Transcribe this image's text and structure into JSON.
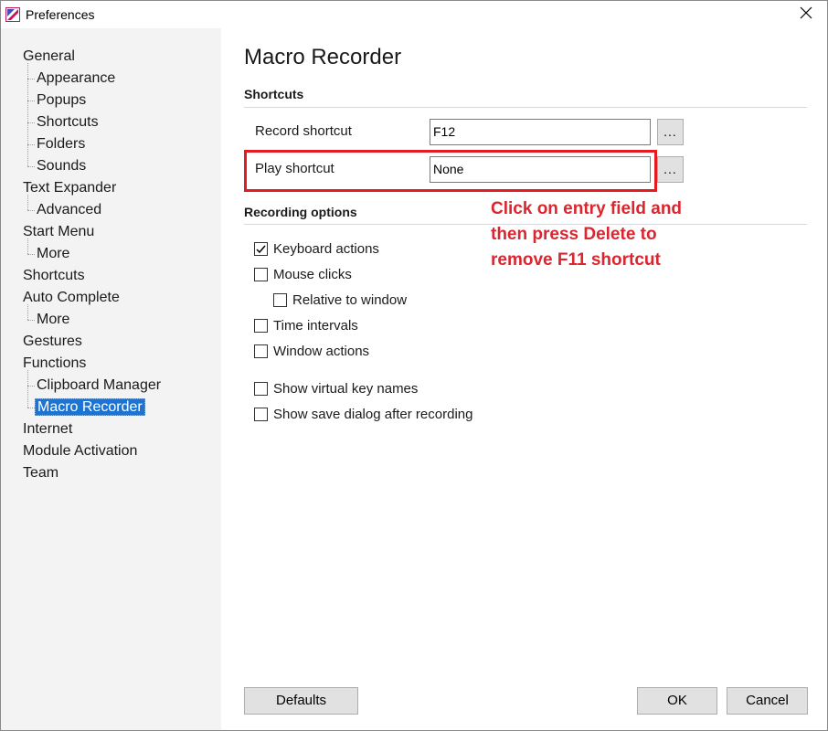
{
  "window": {
    "title": "Preferences",
    "close_glyph": "✕",
    "app_icon": "app-logo-icon"
  },
  "sidebar": {
    "items": [
      {
        "label": "General",
        "level": 0
      },
      {
        "label": "Appearance",
        "level": 1
      },
      {
        "label": "Popups",
        "level": 1
      },
      {
        "label": "Shortcuts",
        "level": 1
      },
      {
        "label": "Folders",
        "level": 1
      },
      {
        "label": "Sounds",
        "level": 1
      },
      {
        "label": "Text Expander",
        "level": 0
      },
      {
        "label": "Advanced",
        "level": 1
      },
      {
        "label": "Start Menu",
        "level": 0
      },
      {
        "label": "More",
        "level": 1
      },
      {
        "label": "Shortcuts",
        "level": 0
      },
      {
        "label": "Auto Complete",
        "level": 0
      },
      {
        "label": "More",
        "level": 1
      },
      {
        "label": "Gestures",
        "level": 0
      },
      {
        "label": "Functions",
        "level": 0
      },
      {
        "label": "Clipboard Manager",
        "level": 1
      },
      {
        "label": "Macro Recorder",
        "level": 1,
        "selected": true
      },
      {
        "label": "Internet",
        "level": 0
      },
      {
        "label": "Module Activation",
        "level": 0
      },
      {
        "label": "Team",
        "level": 0
      }
    ]
  },
  "main": {
    "title": "Macro Recorder",
    "shortcuts_section": "Shortcuts",
    "record_label": "Record shortcut",
    "record_value": "F12",
    "play_label": "Play shortcut",
    "play_value": "None",
    "dots_label": "...",
    "recording_section": "Recording options",
    "options": [
      {
        "label": "Keyboard actions",
        "checked": true
      },
      {
        "label": "Mouse clicks",
        "checked": false
      },
      {
        "label": "Relative to window",
        "checked": false
      },
      {
        "label": "Time intervals",
        "checked": false
      },
      {
        "label": "Window actions",
        "checked": false
      },
      {
        "label": "Show virtual key names",
        "checked": false
      },
      {
        "label": "Show save dialog after recording",
        "checked": false
      }
    ]
  },
  "annotation": {
    "lines": [
      "Click on entry field and",
      "then press Delete to",
      "remove F11 shortcut"
    ],
    "color": "#d9262f"
  },
  "footer": {
    "defaults_label": "Defaults",
    "ok_label": "OK",
    "cancel_label": "Cancel"
  },
  "colors": {
    "selection": "#1b74d4",
    "highlight_border": "#e31b23",
    "sidebar_bg": "#f3f3f3"
  }
}
